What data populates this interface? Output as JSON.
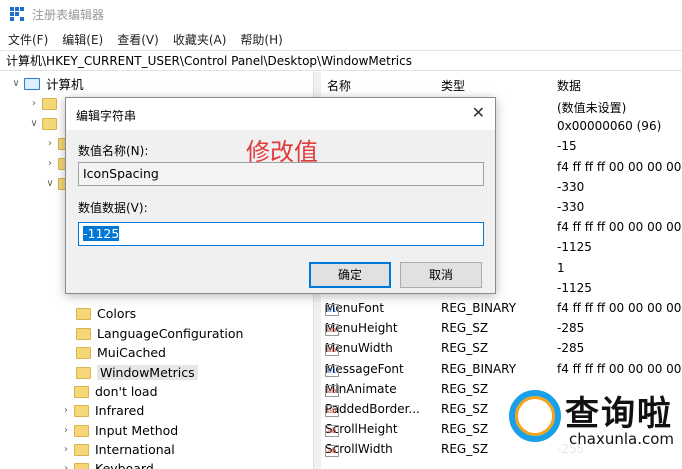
{
  "window": {
    "title": "注册表编辑器"
  },
  "menu": [
    "文件(F)",
    "编辑(E)",
    "查看(V)",
    "收藏夹(A)",
    "帮助(H)"
  ],
  "address": "计算机\\HKEY_CURRENT_USER\\Control Panel\\Desktop\\WindowMetrics",
  "tree": {
    "root": "计算机",
    "items": [
      "Colors",
      "LanguageConfiguration",
      "MuiCached",
      "WindowMetrics",
      "don't load",
      "Infrared",
      "Input Method",
      "International",
      "Keyboard"
    ]
  },
  "list": {
    "columns": [
      "名称",
      "类型",
      "数据"
    ],
    "rows": [
      {
        "name": "",
        "type": "",
        "data": "(数值未设置)",
        "icon": ""
      },
      {
        "name": "",
        "type": "ORD",
        "data": "0x00000060 (96)",
        "icon": ""
      },
      {
        "name": "",
        "type": "",
        "data": "-15",
        "icon": ""
      },
      {
        "name": "",
        "type": "NARY",
        "data": "f4 ff ff ff 00 00 00 00 0",
        "icon": ""
      },
      {
        "name": "",
        "type": "",
        "data": "-330",
        "icon": ""
      },
      {
        "name": "",
        "type": "",
        "data": "-330",
        "icon": ""
      },
      {
        "name": "",
        "type": "NARY",
        "data": "f4 ff ff ff 00 00 00 00 0",
        "icon": ""
      },
      {
        "name": "",
        "type": "",
        "data": "-1125",
        "icon": ""
      },
      {
        "name": "",
        "type": "",
        "data": "1",
        "icon": ""
      },
      {
        "name": "",
        "type": "",
        "data": "-1125",
        "icon": ""
      },
      {
        "name": "MenuFont",
        "type": "REG_BINARY",
        "data": "f4 ff ff ff 00 00 00 00 0",
        "icon": "bin"
      },
      {
        "name": "MenuHeight",
        "type": "REG_SZ",
        "data": "-285",
        "icon": "ab"
      },
      {
        "name": "MenuWidth",
        "type": "REG_SZ",
        "data": "-285",
        "icon": "ab"
      },
      {
        "name": "MessageFont",
        "type": "REG_BINARY",
        "data": "f4 ff ff ff 00 00 00 00 0",
        "icon": "bin"
      },
      {
        "name": "MinAnimate",
        "type": "REG_SZ",
        "data": "",
        "icon": "ab"
      },
      {
        "name": "PaddedBorder...",
        "type": "REG_SZ",
        "data": "",
        "icon": "ab"
      },
      {
        "name": "ScrollHeight",
        "type": "REG_SZ",
        "data": "",
        "icon": "ab"
      },
      {
        "name": "ScrollWidth",
        "type": "REG_SZ",
        "data": "-255",
        "icon": "ab"
      }
    ]
  },
  "dialog": {
    "title": "编辑字符串",
    "name_label": "数值名称(N):",
    "name_value": "IconSpacing",
    "data_label": "数值数据(V):",
    "data_value": "-1125",
    "ok": "确定",
    "cancel": "取消"
  },
  "annotation": {
    "text": "修改值",
    "color": "#e03a3a"
  },
  "watermark": {
    "text": "查询啦",
    "sub": "chaxunla.com"
  },
  "colors": {
    "accent": "#0078d7",
    "folder": "#f5d77a"
  }
}
